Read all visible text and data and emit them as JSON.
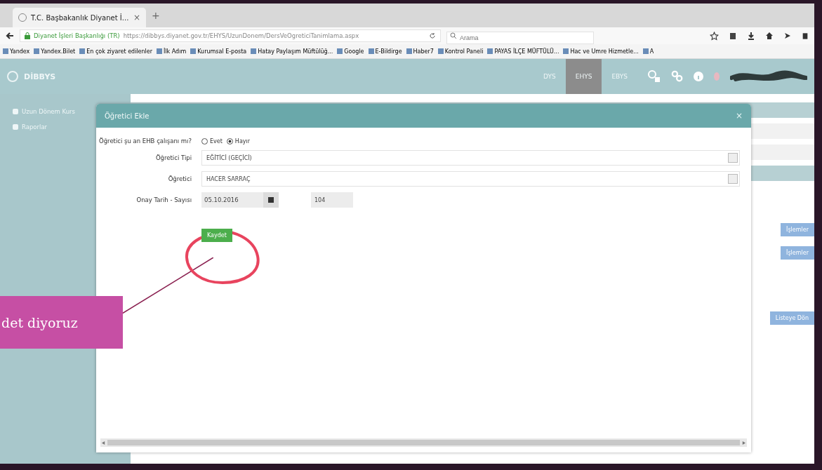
{
  "browser": {
    "tab": {
      "title": "T.C. Başbakanlık Diyanet İ...",
      "close": "×"
    },
    "new_tab": "+",
    "site_identity": "Diyanet İşleri Başkanlığı (TR)",
    "url": "https://dibbys.diyanet.gov.tr/EHYS/UzunDonem/DersVeOgreticiTanimlama.aspx",
    "search": {
      "placeholder": "Arama"
    },
    "bookmarks": [
      {
        "label": "Yandex"
      },
      {
        "label": "Yandex.Bilet"
      },
      {
        "label": "En çok ziyaret edilenler"
      },
      {
        "label": "İlk Adım"
      },
      {
        "label": "Kurumsal E-posta"
      },
      {
        "label": "Hatay Paylaşım Müftülüğ..."
      },
      {
        "label": "Google"
      },
      {
        "label": "E-Bildirge"
      },
      {
        "label": "Haber7"
      },
      {
        "label": "Kontrol Paneli"
      },
      {
        "label": "PAYAS İLÇE MÜFTÜLÜ..."
      },
      {
        "label": "Hac ve Umre Hizmetle..."
      },
      {
        "label": "A"
      }
    ]
  },
  "app": {
    "logo": "DİBBYS",
    "nav": [
      {
        "label": "DYS",
        "selected": false
      },
      {
        "label": "EHYS",
        "selected": true
      },
      {
        "label": "EBYS",
        "selected": false
      }
    ],
    "sidebar": {
      "items": [
        {
          "label": "Uzun Dönem Kurs"
        },
        {
          "label": "Raporlar"
        }
      ]
    },
    "background_buttons": [
      "İşlemler",
      "İşlemler",
      "Listeye Dön"
    ]
  },
  "dialog": {
    "title": "Öğretici Ekle",
    "close": "×",
    "question": "Öğretici şu an EHB çalışanı mı?",
    "options": [
      {
        "label": "Evet",
        "selected": false
      },
      {
        "label": "Hayır",
        "selected": true
      }
    ],
    "fields": [
      {
        "kind": "select",
        "label": "Öğretici Tipi",
        "value": "EĞİTİCİ (GEÇİCİ)"
      },
      {
        "kind": "select",
        "label": "Öğretici",
        "value": "HACER SARRAÇ"
      },
      {
        "kind": "date",
        "label": "Onay Tarih - Sayısı",
        "value": "05.10.2016",
        "number": "104"
      }
    ],
    "save_button": "Kaydet"
  },
  "annotation": {
    "callout": "det diyoruz"
  }
}
